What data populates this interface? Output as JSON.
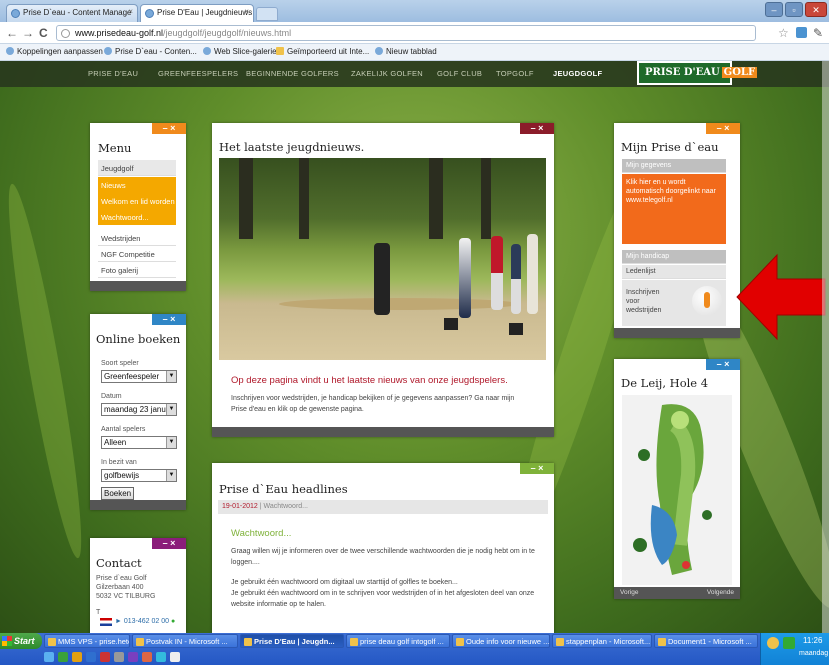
{
  "browser": {
    "tabs": [
      {
        "label": "Prise D`eau - Content Manage"
      },
      {
        "label": "Prise D'Eau | Jeugdnieuws"
      }
    ],
    "url_host": "www.prisedeau-golf.nl",
    "url_path": "/jeugdgolf/jeugdgolf/nieuws.html",
    "bookmarks": [
      "Koppelingen aanpassen",
      "Prise D`eau - Conten...",
      "Web Slice-galerie",
      "Geïmporteerd uit Inte...",
      "Nieuw tabblad"
    ]
  },
  "site": {
    "nav": [
      "PRISE D'EAU",
      "GREENFEESPELERS",
      "BEGINNENDE GOLFERS",
      "ZAKELIJK GOLFEN",
      "GOLF CLUB",
      "TOPGOLF",
      "JEUGDGOLF"
    ],
    "logo": {
      "text": "PRISE D'EAU",
      "accent": "GOLF"
    }
  },
  "menu": {
    "title": "Menu",
    "items": [
      "Jeugdgolf",
      "Nieuws",
      "Welkom en lid worden",
      "Wachtwoord...",
      "Wedstrijden",
      "NGF Competitie",
      "Foto galerij"
    ]
  },
  "booking": {
    "title": "Online boeken",
    "soort_label": "Soort speler",
    "soort_value": "Greenfeespeler",
    "datum_label": "Datum",
    "datum_value": "maandag 23 janu",
    "aantal_label": "Aantal spelers",
    "aantal_value": "Alleen",
    "bezit_label": "In bezit van",
    "bezit_value": "golfbewijs",
    "button": "Boeken"
  },
  "contact": {
    "title": "Contact",
    "lines": [
      "Prise d`eau Golf",
      "Gilzerbaan 400",
      "5032 VC TILBURG"
    ],
    "t_label": "T",
    "phone": "013-462 02 00"
  },
  "news": {
    "title": "Het laatste jeugdnieuws.",
    "highlight": "Op deze pagina vindt u het laatste nieuws van onze jeugdspelers.",
    "body": "Inschrijven voor wedstrijden, je handicap bekijken of je gegevens aanpassen? Ga naar mijn Prise d'eau en klik op de gewenste pagina."
  },
  "headlines": {
    "title": "Prise d`Eau headlines",
    "date": "19-01-2012",
    "date_sub": "| Wachtwoord...",
    "item_title": "Wachtwoord...",
    "p1": "Graag willen wij je informeren over de twee verschillende wachtwoorden die je nodig hebt om in te loggen....",
    "p2": "Je gebruikt één wachtwoord om digitaal uw starttijd of golfles te boeken...",
    "p3": "Je gebruikt één wachtwoord om in te schrijven voor wedstrijden of in het afgesloten deel van onze website informatie op te halen."
  },
  "mijn": {
    "title": "Mijn Prise d`eau",
    "gegevens": "Mijn gegevens",
    "promo": "Klik hier en u wordt automatisch doorgelinkt naar www.telegolf.nl",
    "handicap": "Mijn handicap",
    "ledenlijst": "Ledenlijst",
    "inschrijven": "Inschrijven voor wedstrijden"
  },
  "hole": {
    "title": "De Leij, Hole 4",
    "prev": "Vorige",
    "next": "Volgende"
  },
  "taskbar": {
    "start": "Start",
    "tasks": [
      "MMS VPS - prise.hetdigi...",
      "Postvak IN - Microsoft ...",
      "Prise D'Eau | Jeugdn...",
      "prise deau golf intogolf ...",
      "Oude info voor nieuwe ...",
      "stappenplan - Microsoft...",
      "Document1 - Microsoft ..."
    ],
    "time": "11:26",
    "day": "maandag"
  },
  "colors": {
    "orange": "#f08a1c",
    "blue": "#2f86c6",
    "maroon": "#8b1c2a",
    "purple": "#8b1d7a",
    "green": "#7fb23a",
    "red_arrow": "#e10000"
  }
}
